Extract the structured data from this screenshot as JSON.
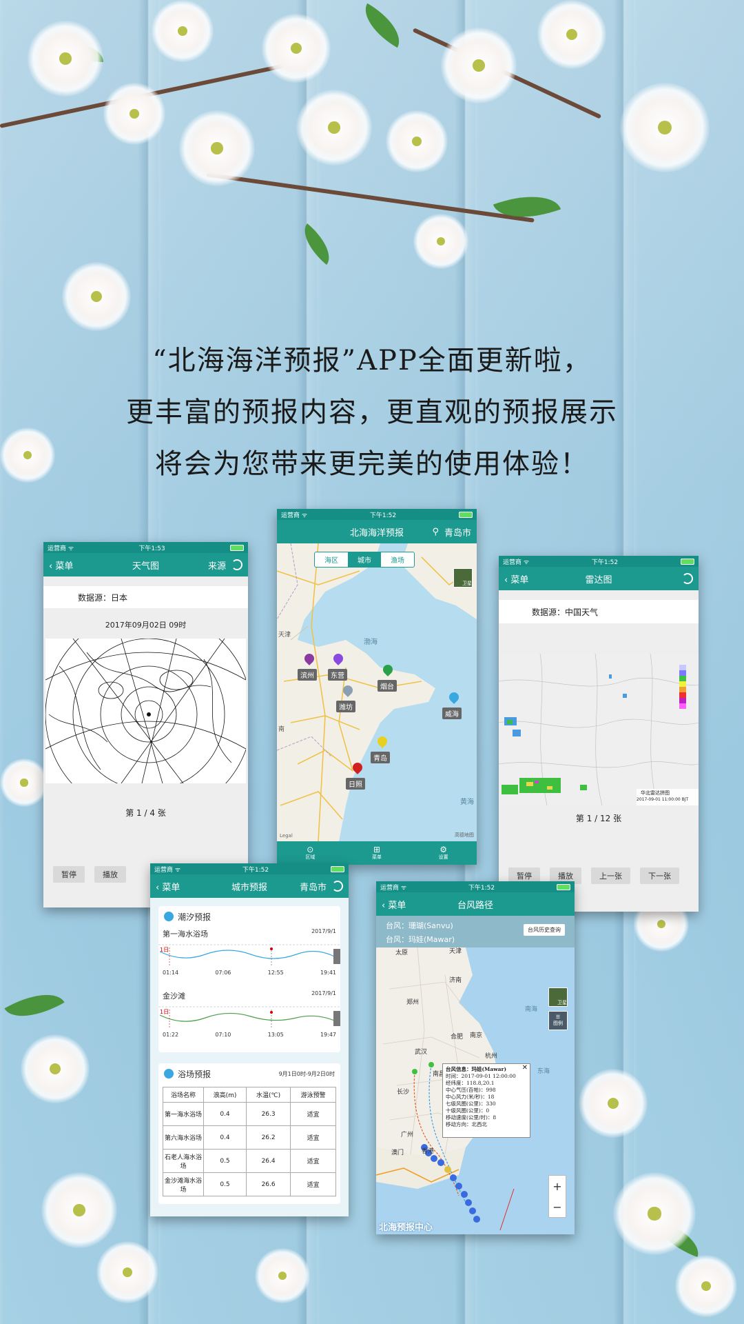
{
  "headline": {
    "line1": "“北海海洋预报”APP全面更新啦，",
    "line2": "更丰富的预报内容，更直观的预报展示",
    "line3": "将会为您带来更完美的使用体验！"
  },
  "weather_screen": {
    "status_left": "运营商 ᯤ",
    "status_time": "下午1:53",
    "back_label": "菜单",
    "title": "天气图",
    "source_button": "来源",
    "data_source": "数据源：日本",
    "chart_time": "2017年09月02日 09时",
    "page_info": "第 1 / 4 张",
    "pause_button": "暂停",
    "play_button": "播放"
  },
  "city_map_screen": {
    "status_left": "运营商 ᯤ",
    "status_time": "下午1:52",
    "title": "北海海洋预报",
    "location": "青岛市",
    "tabs": [
      "海区",
      "城市",
      "渔场"
    ],
    "satellite_label": "卫星",
    "sea_labels": [
      "渤海",
      "黄海"
    ],
    "cities": [
      "滨州",
      "东营",
      "烟台",
      "潍坊",
      "威海",
      "青岛",
      "日照"
    ],
    "side_labels": [
      "天津",
      "南"
    ],
    "map_logo": "高德地图",
    "legal": "Legal",
    "bottom_tabs": [
      "区域",
      "菜单",
      "设置"
    ]
  },
  "radar_screen": {
    "status_left": "运营商 ᯤ",
    "status_time": "下午1:52",
    "back_label": "菜单",
    "title": "雷达图",
    "data_source": "数据源：中国天气",
    "image_caption": "华北雷达拼图",
    "image_time": "2017-09-01 11:00:00 BJT",
    "page_info": "第 1 / 12 张",
    "buttons": [
      "暂停",
      "播放",
      "上一张",
      "下一张"
    ]
  },
  "city_forecast_screen": {
    "status_left": "运营商 ᯤ",
    "status_time": "下午1:52",
    "back_label": "菜单",
    "title": "城市预报",
    "location": "青岛市",
    "tide_title": "潮汐预报",
    "tides": [
      {
        "name": "第一海水浴场",
        "date": "2017/9/1",
        "times": [
          "01:14",
          "07:06",
          "12:55",
          "19:41"
        ],
        "day": "1日"
      },
      {
        "name": "金沙滩",
        "date": "2017/9/1",
        "times": [
          "01:22",
          "07:10",
          "13:05",
          "19:47"
        ],
        "day": "1日"
      }
    ],
    "beach_title": "浴场预报",
    "beach_date": "9月1日0时-9月2日0时",
    "table_headers": [
      "浴场名称",
      "浪高(m)",
      "水温(℃)",
      "游泳预警"
    ],
    "table_rows": [
      [
        "第一海水浴场",
        "0.4",
        "26.3",
        "适宜"
      ],
      [
        "第六海水浴场",
        "0.4",
        "26.2",
        "适宜"
      ],
      [
        "石老人海水浴场",
        "0.5",
        "26.4",
        "适宜"
      ],
      [
        "金沙滩海水浴场",
        "0.5",
        "26.6",
        "适宜"
      ]
    ]
  },
  "typhoon_screen": {
    "status_left": "运营商 ᯤ",
    "status_time": "下午1:52",
    "back_label": "菜单",
    "title": "台风路径",
    "typhoon1": "台风：珊瑚(Sanvu)",
    "typhoon2": "台风：玛娃(Mawar)",
    "history_button": "台风历史查询",
    "satellite_label": "卫星",
    "legend_label": "图例",
    "map_labels": [
      "太原",
      "天津",
      "济南",
      "郑州",
      "南海",
      "合肥",
      "南京",
      "武汉",
      "杭州",
      "南昌",
      "东海",
      "长沙",
      "广州",
      "澳门",
      "香港"
    ],
    "info_title": "台风信息：玛娃(Mawar)",
    "info_lines": [
      "时间：2017-09-01 12:00:00",
      "经纬度：118.8,20.1",
      "中心气压(百帕)：998",
      "中心风力(米/秒)：18",
      "七级风圈(公里)：330",
      "十级风圈(公里)：0",
      "移动速度(公里/时)：8",
      "移动方向：北西北"
    ],
    "zoom_in": "+",
    "zoom_out": "−",
    "watermark": "北海预报中心"
  }
}
